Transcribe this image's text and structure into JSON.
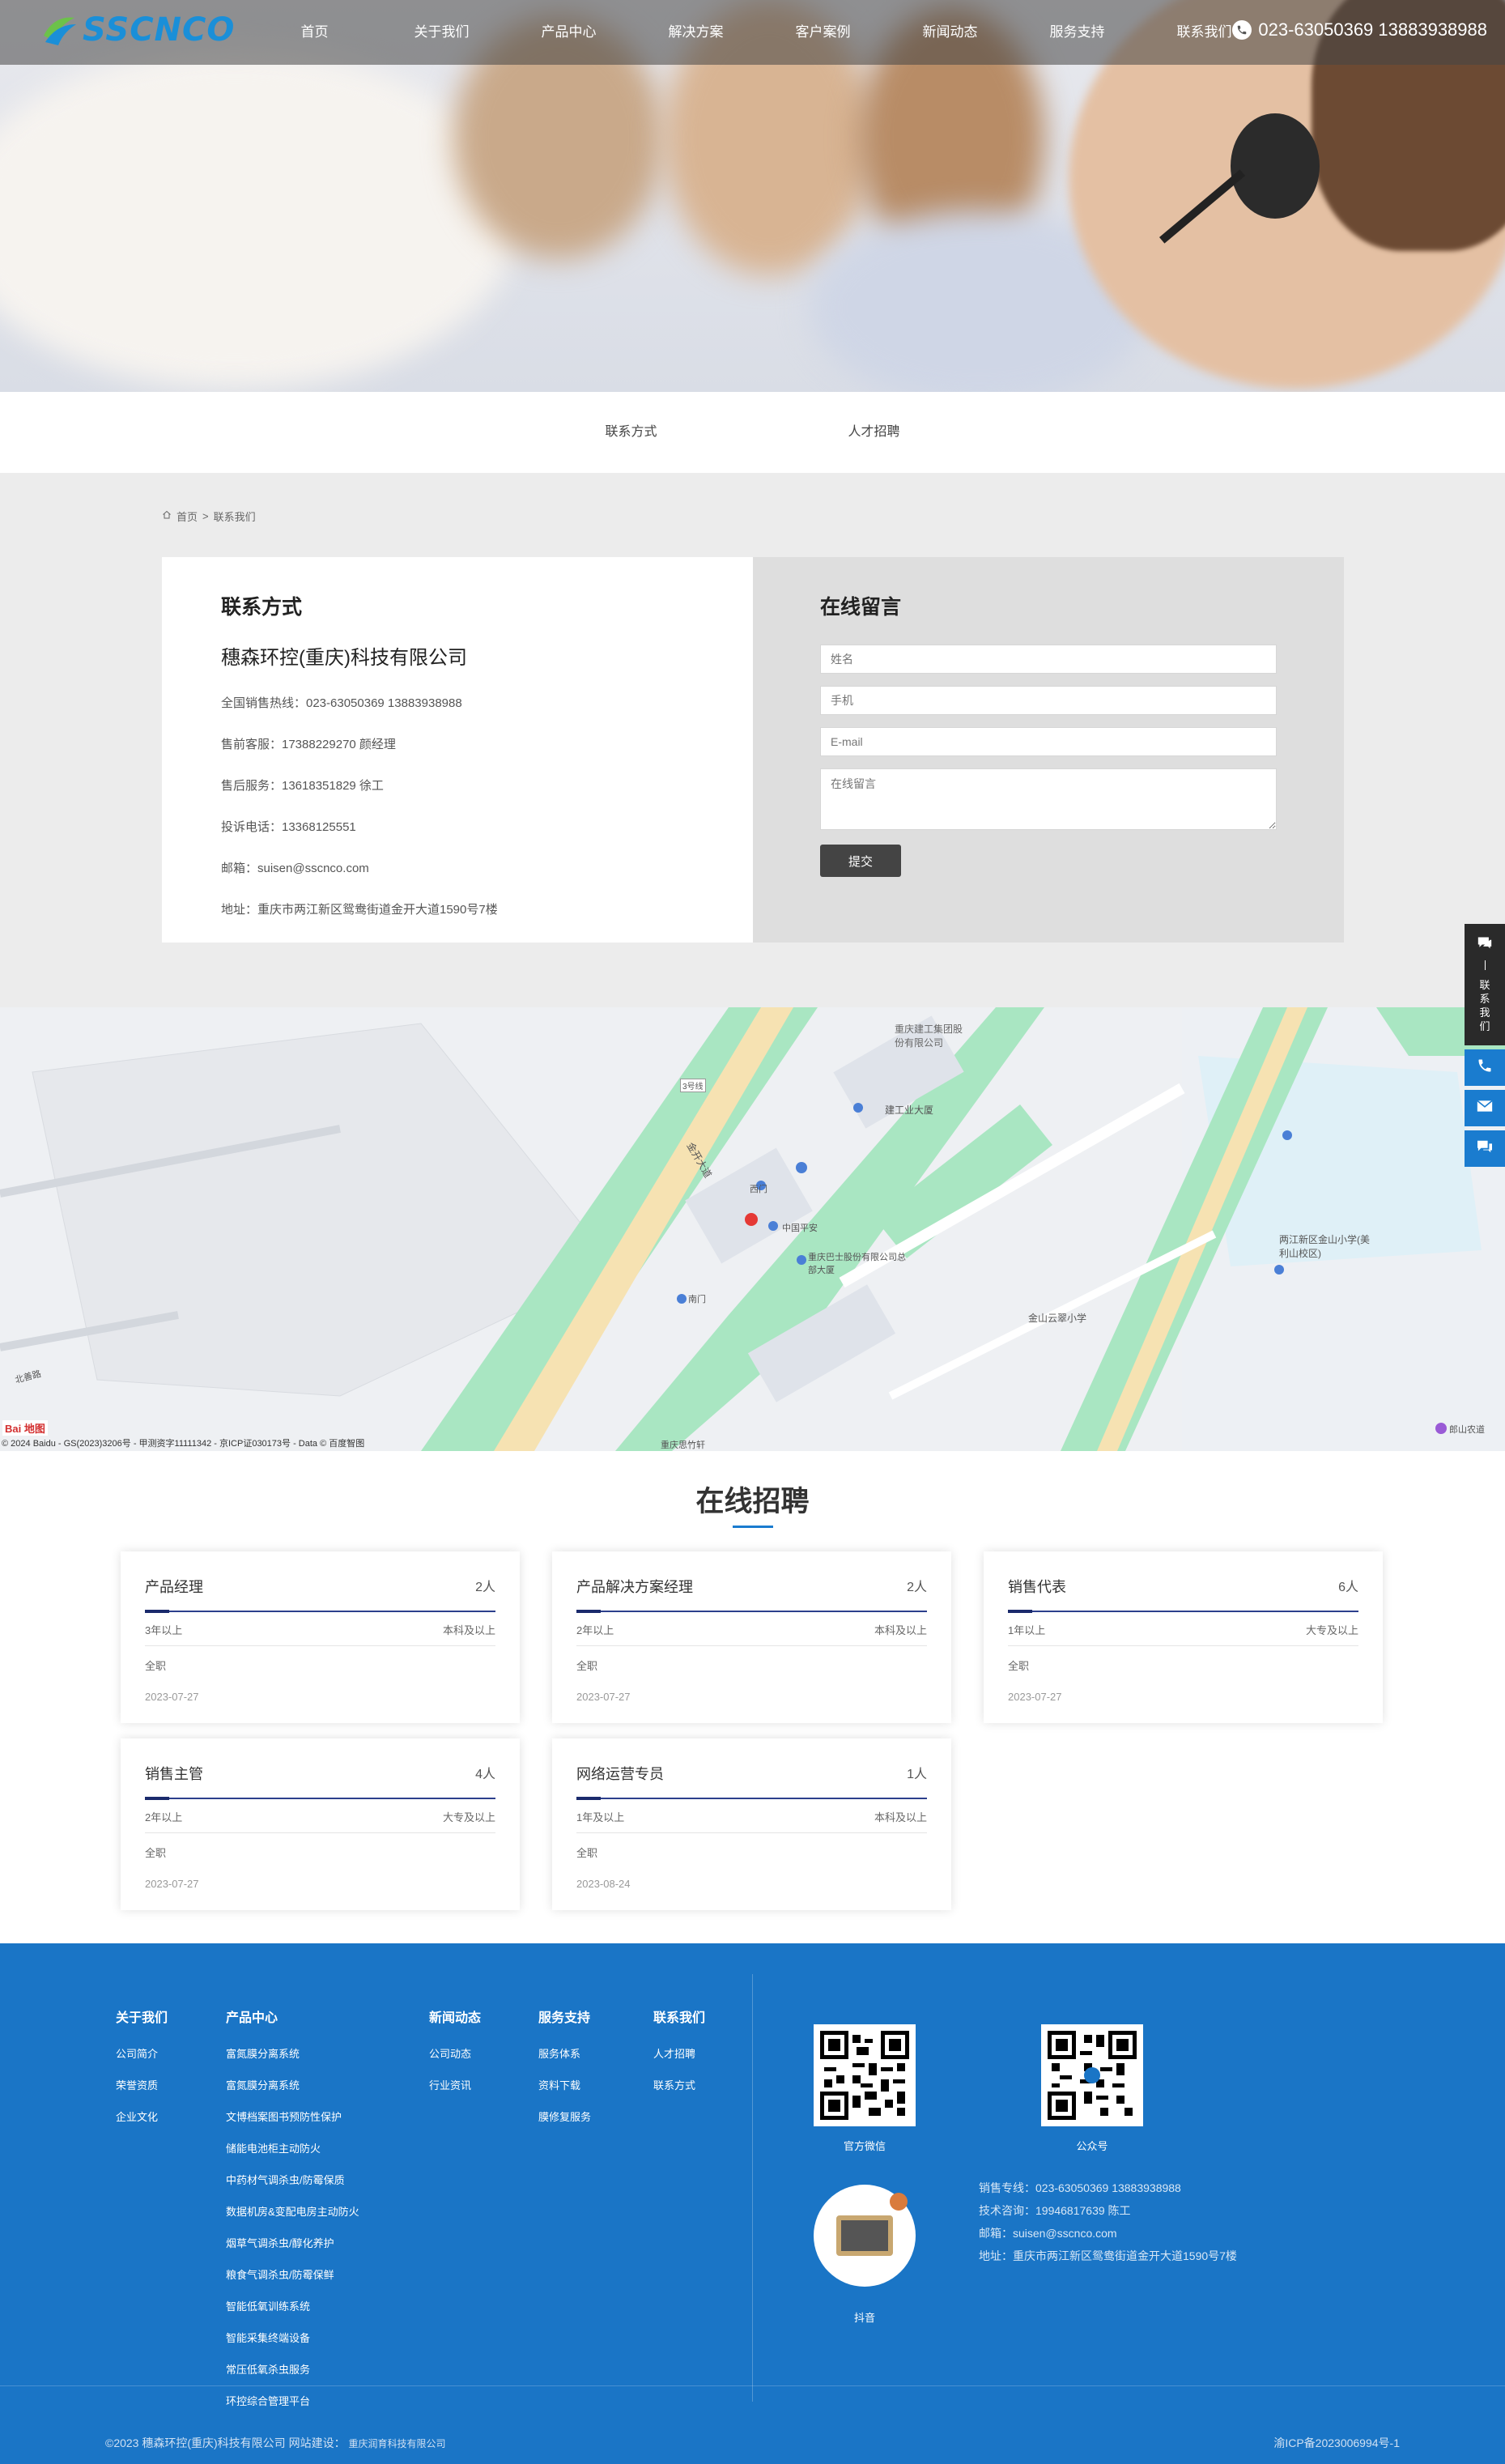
{
  "header": {
    "logo_text": "SSCNCO",
    "nav": [
      "首页",
      "关于我们",
      "产品中心",
      "解决方案",
      "客户案例",
      "新闻动态",
      "服务支持",
      "联系我们"
    ],
    "hotline": "023-63050369 13883938988"
  },
  "subtabs": [
    "联系方式",
    "人才招聘"
  ],
  "breadcrumb": {
    "home": "首页",
    "sep": ">",
    "current": "联系我们"
  },
  "contact": {
    "title": "联系方式",
    "company": "穗森环控(重庆)科技有限公司",
    "lines": [
      "全国销售热线：023-63050369 13883938988",
      "售前客服：17388229270 颜经理",
      "售后服务：13618351829 徐工",
      "投诉电话：13368125551",
      "邮箱：suisen@sscnco.com",
      "地址：重庆市两江新区鸳鸯街道金开大道1590号7楼"
    ]
  },
  "form": {
    "title": "在线留言",
    "name_placeholder": "姓名",
    "phone_placeholder": "手机",
    "email_placeholder": "E-mail",
    "message_placeholder": "在线留言",
    "submit": "提交"
  },
  "side": {
    "label": "联系我们"
  },
  "map": {
    "labels": [
      "重庆建工集团股份有限公司",
      "建工业大厦",
      "西门",
      "中国平安",
      "重庆巴士股份有限公司总部大厦",
      "南门",
      "金山云翠小学",
      "两江新区金山小学(美利山校区)",
      "北善路",
      "金开大道",
      "重庆思竹轩",
      "郎山农道",
      "3号线"
    ],
    "copyright": "© 2024 Baidu - GS(2023)3206号 - 甲测资字11111342 - 京ICP证030173号 - Data © 百度智图",
    "brand": "Bai 地图"
  },
  "recruit": {
    "title": "在线招聘",
    "jobs": [
      {
        "title": "产品经理",
        "count": "2人",
        "exp": "3年以上",
        "edu": "本科及以上",
        "type": "全职",
        "date": "2023-07-27"
      },
      {
        "title": "产品解决方案经理",
        "count": "2人",
        "exp": "2年以上",
        "edu": "本科及以上",
        "type": "全职",
        "date": "2023-07-27"
      },
      {
        "title": "销售代表",
        "count": "6人",
        "exp": "1年以上",
        "edu": "大专及以上",
        "type": "全职",
        "date": "2023-07-27"
      },
      {
        "title": "销售主管",
        "count": "4人",
        "exp": "2年以上",
        "edu": "大专及以上",
        "type": "全职",
        "date": "2023-07-27"
      },
      {
        "title": "网络运营专员",
        "count": "1人",
        "exp": "1年及以上",
        "edu": "本科及以上",
        "type": "全职",
        "date": "2023-08-24"
      }
    ]
  },
  "footer": {
    "cols": [
      {
        "title": "关于我们",
        "links": [
          "公司简介",
          "荣誉资质",
          "企业文化"
        ]
      },
      {
        "title": "产品中心",
        "links": [
          "富氮膜分离系统",
          "富氮膜分离系统",
          "文博档案图书预防性保护",
          "储能电池柜主动防火",
          "中药材气调杀虫/防霉保质",
          "数据机房&变配电房主动防火",
          "烟草气调杀虫/醇化养护",
          "粮食气调杀虫/防霉保鲜",
          "智能低氧训练系统",
          "智能采集终端设备",
          "常压低氧杀虫服务",
          "环控综合管理平台"
        ]
      },
      {
        "title": "新闻动态",
        "links": [
          "公司动态",
          "行业资讯"
        ]
      },
      {
        "title": "服务支持",
        "links": [
          "服务体系",
          "资料下载",
          "膜修复服务"
        ]
      },
      {
        "title": "联系我们",
        "links": [
          "人才招聘",
          "联系方式"
        ]
      }
    ],
    "qr": [
      "官方微信",
      "公众号",
      "抖音"
    ],
    "contact": [
      "销售专线：023-63050369 13883938988",
      "技术咨询：19946817639 陈工",
      "邮箱：suisen@sscnco.com",
      "地址：重庆市两江新区鸳鸯街道金开大道1590号7楼"
    ],
    "copyright": "©2023 穗森环控(重庆)科技有限公司  网站建设：",
    "builder": "重庆润育科技有限公司",
    "icp": "渝ICP备2023006994号-1"
  },
  "colors": {
    "brand_blue": "#1a75c6",
    "accent": "#1a7ccf",
    "header_bg": "#464646"
  }
}
